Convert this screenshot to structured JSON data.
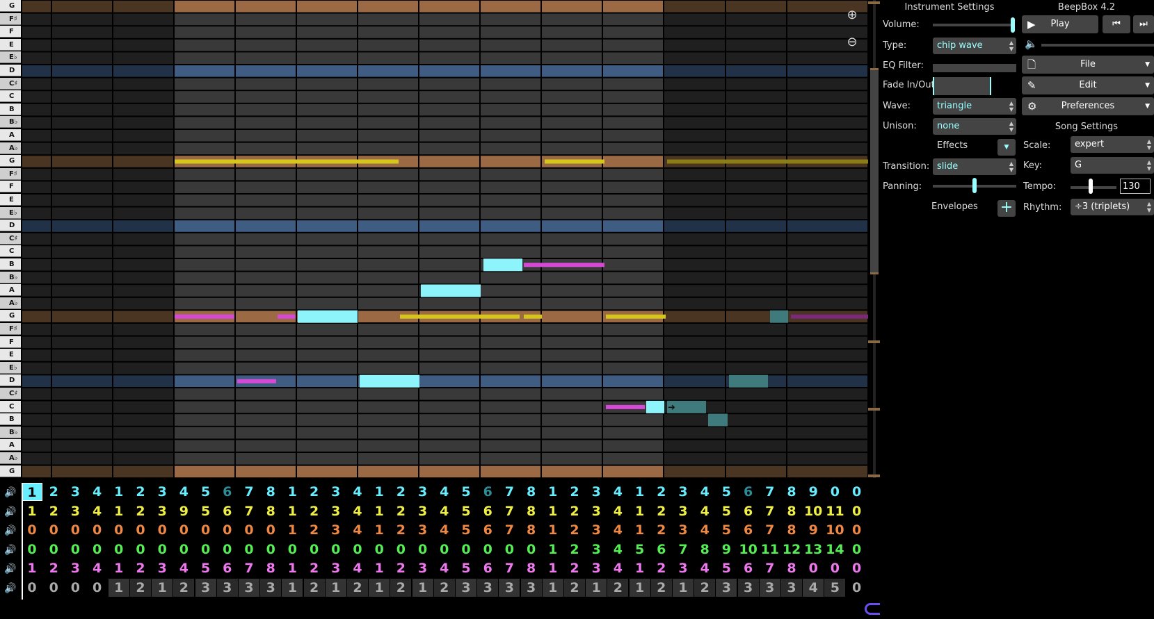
{
  "app": {
    "title": "BeepBox 4.2"
  },
  "piano_keys": [
    "G",
    "F♯",
    "F",
    "E",
    "E♭",
    "D",
    "C♯",
    "C",
    "B",
    "B♭",
    "A",
    "A♭",
    "G",
    "F♯",
    "F",
    "E",
    "E♭",
    "D",
    "C♯",
    "C",
    "B",
    "B♭",
    "A",
    "A♭",
    "G",
    "F♯",
    "F",
    "E",
    "E♭",
    "D",
    "C♯",
    "C",
    "B",
    "B♭",
    "A",
    "A♭",
    "G"
  ],
  "zoom": {
    "zoom_in": "zoom-in-icon",
    "zoom_out": "zoom-out-icon"
  },
  "patterns": {
    "channels": [
      {
        "color": "#6ef",
        "values": [
          "1",
          "2",
          "3",
          "4",
          "1",
          "2",
          "3",
          "4",
          "5",
          "6",
          "7",
          "8",
          "1",
          "2",
          "3",
          "4",
          "1",
          "2",
          "3",
          "4",
          "5",
          "6",
          "7",
          "8",
          "1",
          "2",
          "3",
          "4",
          "1",
          "2",
          "3",
          "4",
          "5",
          "6",
          "7",
          "8",
          "9",
          "0",
          "0"
        ]
      },
      {
        "color": "#ee4",
        "values": [
          "1",
          "2",
          "3",
          "4",
          "1",
          "2",
          "3",
          "9",
          "5",
          "6",
          "7",
          "8",
          "1",
          "2",
          "3",
          "4",
          "1",
          "2",
          "3",
          "4",
          "5",
          "6",
          "7",
          "8",
          "1",
          "2",
          "3",
          "4",
          "1",
          "2",
          "3",
          "4",
          "5",
          "6",
          "7",
          "8",
          "10",
          "11",
          "0"
        ]
      },
      {
        "color": "#e84",
        "values": [
          "0",
          "0",
          "0",
          "0",
          "0",
          "0",
          "0",
          "0",
          "0",
          "0",
          "0",
          "0",
          "1",
          "2",
          "3",
          "4",
          "1",
          "2",
          "3",
          "4",
          "5",
          "6",
          "7",
          "8",
          "1",
          "2",
          "3",
          "4",
          "1",
          "2",
          "3",
          "4",
          "5",
          "6",
          "7",
          "8",
          "9",
          "10",
          "0"
        ]
      },
      {
        "color": "#5e5",
        "values": [
          "0",
          "0",
          "0",
          "0",
          "0",
          "0",
          "0",
          "0",
          "0",
          "0",
          "0",
          "0",
          "0",
          "0",
          "0",
          "0",
          "0",
          "0",
          "0",
          "0",
          "0",
          "0",
          "0",
          "0",
          "1",
          "2",
          "3",
          "4",
          "5",
          "6",
          "7",
          "8",
          "9",
          "10",
          "11",
          "12",
          "13",
          "14",
          "0"
        ]
      },
      {
        "color": "#e7e",
        "values": [
          "1",
          "2",
          "3",
          "4",
          "1",
          "2",
          "3",
          "4",
          "5",
          "6",
          "7",
          "8",
          "1",
          "2",
          "3",
          "4",
          "1",
          "2",
          "3",
          "4",
          "5",
          "6",
          "7",
          "8",
          "1",
          "2",
          "3",
          "4",
          "1",
          "2",
          "3",
          "4",
          "5",
          "6",
          "7",
          "8",
          "0",
          "0",
          "0"
        ]
      },
      {
        "color": "#aaa",
        "values": [
          "0",
          "0",
          "0",
          "0",
          "1",
          "2",
          "1",
          "2",
          "3",
          "3",
          "3",
          "3",
          "1",
          "2",
          "1",
          "2",
          "1",
          "2",
          "1",
          "2",
          "3",
          "3",
          "3",
          "3",
          "1",
          "2",
          "1",
          "2",
          "1",
          "2",
          "1",
          "2",
          "3",
          "3",
          "3",
          "3",
          "4",
          "5",
          "0"
        ]
      }
    ]
  },
  "instrument_settings": {
    "header": "Instrument Settings",
    "volume_label": "Volume:",
    "volume_level": 1.0,
    "type_label": "Type:",
    "type_value": "chip wave",
    "eq_label": "EQ Filter:",
    "fade_label": "Fade In/Out:",
    "wave_label": "Wave:",
    "wave_value": "triangle",
    "unison_label": "Unison:",
    "unison_value": "none",
    "effects_label": "Effects",
    "transition_label": "Transition:",
    "transition_value": "slide",
    "panning_label": "Panning:",
    "panning_level": 0.5,
    "envelopes_label": "Envelopes",
    "add_envelope": "+"
  },
  "transport": {
    "play_label": "Play",
    "play_icon": "play-icon",
    "prev_icon": "skip-back-icon",
    "next_icon": "skip-forward-icon",
    "volume_icon": "speaker-icon"
  },
  "menus": {
    "file_label": "File",
    "edit_label": "Edit",
    "preferences_label": "Preferences"
  },
  "song_settings": {
    "header": "Song Settings",
    "scale_label": "Scale:",
    "scale_value": "expert",
    "key_label": "Key:",
    "key_value": "G",
    "tempo_label": "Tempo:",
    "tempo_value": "130",
    "rhythm_label": "Rhythm:",
    "rhythm_value": "÷3 (triplets)"
  }
}
